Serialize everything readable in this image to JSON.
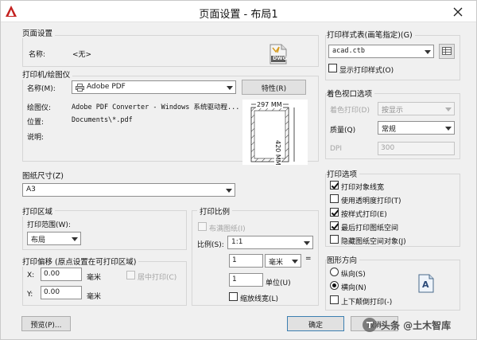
{
  "window": {
    "title": "页面设置 - 布局1"
  },
  "page_setup": {
    "group_label": "页面设置",
    "name_label": "名称:",
    "name_value": "<无>",
    "file_icon_text": "DWG"
  },
  "printer": {
    "group_label": "打印机/绘图仪",
    "name_label": "名称(M):",
    "name_value": "Adobe PDF",
    "properties_button": "特性(R)",
    "plotter_label": "绘图仪:",
    "plotter_value": "Adobe PDF Converter - Windows 系统驱动程...",
    "location_label": "位置:",
    "location_value": "Documents\\*.pdf",
    "description_label": "说明:",
    "preview_width_label": "297 MM",
    "preview_height_label": "420 MM"
  },
  "paper_size": {
    "group_label": "图纸尺寸(Z)",
    "value": "A3"
  },
  "plot_area": {
    "group_label": "打印区域",
    "range_label": "打印范围(W):",
    "range_value": "布局"
  },
  "plot_offset": {
    "group_label": "打印偏移 (原点设置在可打印区域)",
    "x_label": "X:",
    "x_value": "0.00",
    "x_unit": "毫米",
    "y_label": "Y:",
    "y_value": "0.00",
    "y_unit": "毫米",
    "center_label": "居中打印(C)"
  },
  "plot_scale": {
    "group_label": "打印比例",
    "fit_label": "布满图纸(I)",
    "scale_label": "比例(S):",
    "scale_value": "1:1",
    "value1": "1",
    "unit1": "毫米",
    "equals": "=",
    "value2": "1",
    "unit2": "单位(U)",
    "lineweight_label": "缩放线宽(L)"
  },
  "plot_style": {
    "group_label": "打印样式表(画笔指定)(G)",
    "value": "acad.ctb",
    "show_label": "显示打印样式(O)"
  },
  "viewport": {
    "group_label": "着色视口选项",
    "shade_label": "着色打印(D)",
    "shade_value": "按显示",
    "quality_label": "质量(Q)",
    "quality_value": "常规",
    "dpi_label": "DPI",
    "dpi_value": "300"
  },
  "plot_options": {
    "group_label": "打印选项",
    "items": [
      {
        "label": "打印对象线宽",
        "checked": true
      },
      {
        "label": "使用透明度打印(T)",
        "checked": false
      },
      {
        "label": "按样式打印(E)",
        "checked": true
      },
      {
        "label": "最后打印图纸空间",
        "checked": true
      },
      {
        "label": "隐藏图纸空间对象(J)",
        "checked": false
      }
    ]
  },
  "orientation": {
    "group_label": "图形方向",
    "portrait_label": "纵向(S)",
    "landscape_label": "横向(N)",
    "upside_down_label": "上下颠倒打印(-)",
    "icon_letter": "A"
  },
  "footer": {
    "preview_button": "预览(P)...",
    "ok_button": "确定",
    "cancel_button": "取消"
  },
  "watermark": {
    "text": "头条 @土木智库"
  },
  "colors": {
    "accent": "#c4211f",
    "window_bg": "#f0f0f0"
  }
}
